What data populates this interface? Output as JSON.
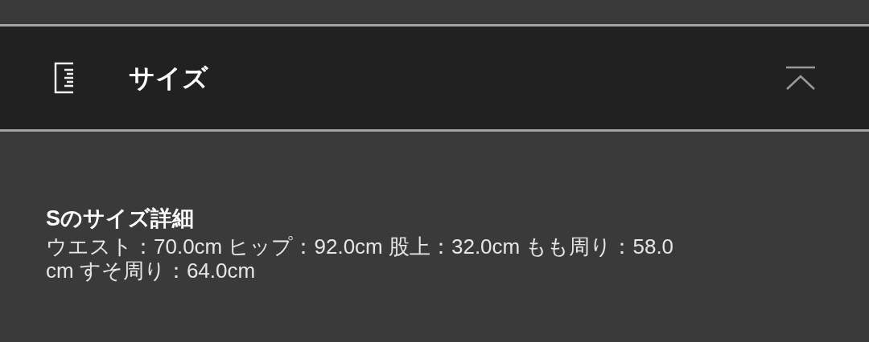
{
  "section": {
    "title": "サイズ",
    "expanded": true
  },
  "detail": {
    "heading": "Sのサイズ詳細",
    "lines": [
      "ウエスト：70.0cm ヒップ：92.0cm 股上：32.0cm もも周り：58.0",
      "cm すそ周り：64.0cm"
    ]
  }
}
